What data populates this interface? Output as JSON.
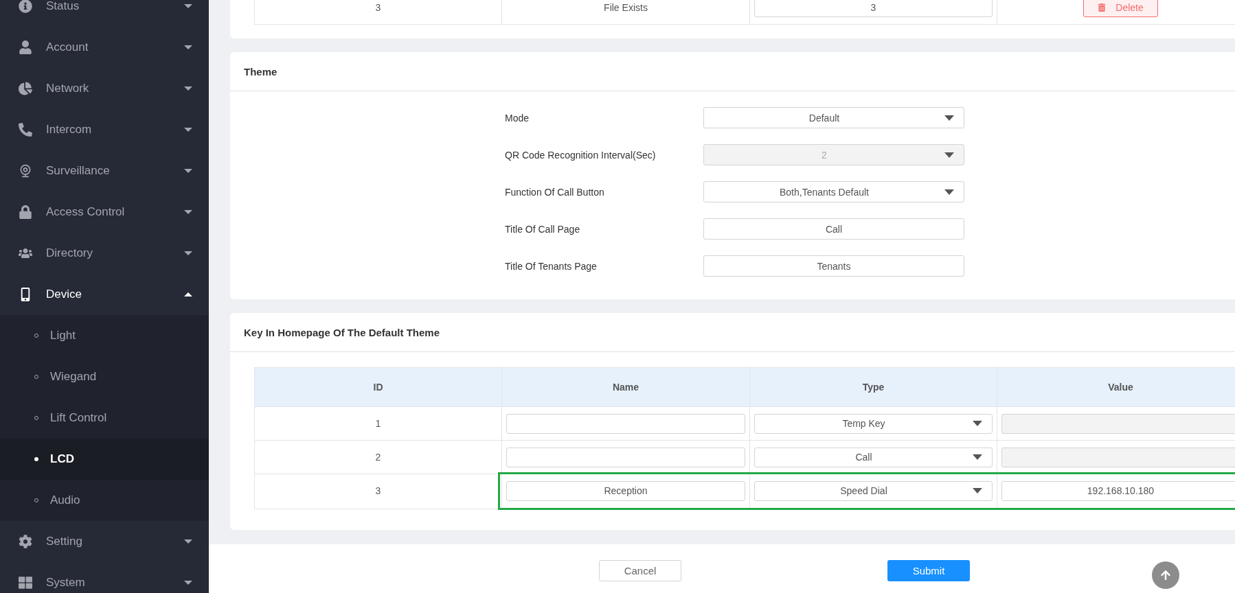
{
  "sidebar": {
    "items": [
      {
        "label": "Status",
        "expanded": false
      },
      {
        "label": "Account",
        "expanded": false
      },
      {
        "label": "Network",
        "expanded": false
      },
      {
        "label": "Intercom",
        "expanded": false
      },
      {
        "label": "Surveillance",
        "expanded": false
      },
      {
        "label": "Access Control",
        "expanded": false
      },
      {
        "label": "Directory",
        "expanded": false
      },
      {
        "label": "Device",
        "expanded": true,
        "children": [
          {
            "label": "Light",
            "selected": false
          },
          {
            "label": "Wiegand",
            "selected": false
          },
          {
            "label": "Lift Control",
            "selected": false
          },
          {
            "label": "LCD",
            "selected": true
          },
          {
            "label": "Audio",
            "selected": false
          }
        ]
      },
      {
        "label": "Setting",
        "expanded": false
      },
      {
        "label": "System",
        "expanded": false
      }
    ]
  },
  "previous_table": {
    "partial_row": {
      "id": "3",
      "name": "File Exists",
      "value": "3",
      "action": "Delete"
    }
  },
  "theme": {
    "title": "Theme",
    "fields": [
      {
        "label": "Mode",
        "kind": "select",
        "value": "Default",
        "disabled": false
      },
      {
        "label": "QR Code Recognition Interval(Sec)",
        "kind": "select",
        "value": "2",
        "disabled": true
      },
      {
        "label": "Function Of Call Button",
        "kind": "select",
        "value": "Both,Tenants Default",
        "disabled": false
      },
      {
        "label": "Title Of Call Page",
        "kind": "text",
        "value": "Call",
        "disabled": false
      },
      {
        "label": "Title Of Tenants Page",
        "kind": "text",
        "value": "Tenants",
        "disabled": false
      }
    ]
  },
  "homepage_keys": {
    "title": "Key In Homepage Of The Default Theme",
    "columns": [
      "ID",
      "Name",
      "Type",
      "Value"
    ],
    "rows": [
      {
        "id": "1",
        "type": "Temp Key",
        "value_disabled": true,
        "highlighted": false
      },
      {
        "id": "2",
        "type": "Call",
        "value_disabled": true,
        "highlighted": false
      },
      {
        "id": "3",
        "name": "Reception",
        "type": "Speed Dial",
        "value": "192.168.10.180",
        "value_disabled": false,
        "highlighted": true
      }
    ]
  },
  "footer": {
    "cancel": "Cancel",
    "submit": "Submit"
  }
}
